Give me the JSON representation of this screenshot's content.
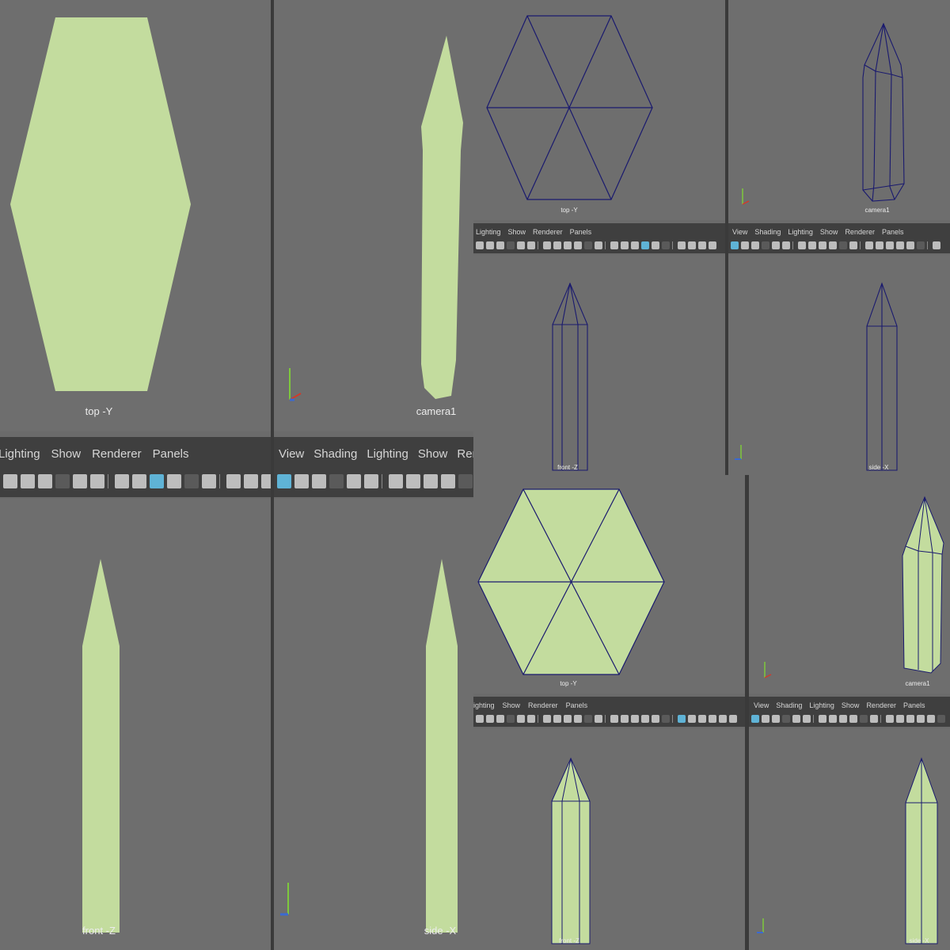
{
  "menus": {
    "left_short": [
      "Lighting",
      "Show",
      "Renderer",
      "Panels"
    ],
    "left_clipped": [
      "ighting",
      "Show",
      "Renderer",
      "Panels"
    ],
    "right_full": [
      "View",
      "Shading",
      "Lighting",
      "Show",
      "Renderer",
      "Panels"
    ]
  },
  "labels": {
    "top": "top -Y",
    "camera": "camera1",
    "front": "front -Z",
    "side": "side -X"
  },
  "axis_labels": {
    "y": "Y",
    "x": "X",
    "z": "Z"
  },
  "toolbar_icons": [
    "camera-icon",
    "camera-attr-icon",
    "bookmark-icon",
    "image-plane-icon",
    "grid-icon",
    "film-gate-icon",
    "resolution-gate-icon",
    "safe-area-icon",
    "wireframe-icon",
    "smooth-shade-icon",
    "textured-icon",
    "lights-icon",
    "shadows-icon",
    "ambient-occlusion-icon",
    "isolate-icon",
    "xray-icon"
  ],
  "colors": {
    "shaded": "#c3dc9e",
    "wire": "#1a1a6e",
    "viewport_bg": "#6e6e6e",
    "toolbar_bg": "#3f3f3f",
    "highlight": "#5fb3d6",
    "axis_y": "#7ec83c",
    "axis_x": "#d23a2a",
    "axis_z": "#3a6ad2"
  }
}
